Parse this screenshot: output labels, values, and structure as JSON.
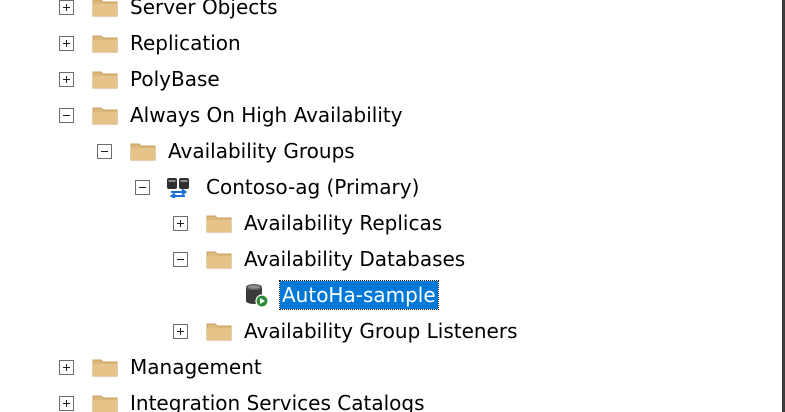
{
  "colors": {
    "folder": "#dcb67a",
    "folder_dark": "#c8a15e",
    "selection": "#0078d7",
    "selection_text": "#ffffff",
    "db_icon": "#3a3a3a",
    "db_badge": "#2e8b3a"
  },
  "tree": {
    "server_objects": {
      "label": "Server Objects",
      "state": "collapsed",
      "icon": "folder-icon"
    },
    "replication": {
      "label": "Replication",
      "state": "collapsed",
      "icon": "folder-icon"
    },
    "polybase": {
      "label": "PolyBase",
      "state": "collapsed",
      "icon": "folder-icon"
    },
    "always_on": {
      "label": "Always On High Availability",
      "state": "expanded",
      "icon": "folder-icon"
    },
    "availability_groups": {
      "label": "Availability Groups",
      "state": "expanded",
      "icon": "folder-icon"
    },
    "contoso_ag": {
      "label": "Contoso-ag (Primary)",
      "state": "expanded",
      "icon": "availability-group-icon"
    },
    "availability_replicas": {
      "label": "Availability Replicas",
      "state": "collapsed",
      "icon": "folder-icon"
    },
    "availability_databases": {
      "label": "Availability Databases",
      "state": "expanded",
      "icon": "folder-icon"
    },
    "autoha_sample": {
      "label": "AutoHa-sample",
      "state": "selected",
      "icon": "database-synchronized-icon"
    },
    "availability_group_listeners": {
      "label": "Availability Group Listeners",
      "state": "collapsed",
      "icon": "folder-icon"
    },
    "management": {
      "label": "Management",
      "state": "collapsed",
      "icon": "folder-icon"
    },
    "integration_services_catalogs": {
      "label": "Integration Services Catalogs",
      "state": "collapsed",
      "icon": "folder-icon"
    }
  }
}
